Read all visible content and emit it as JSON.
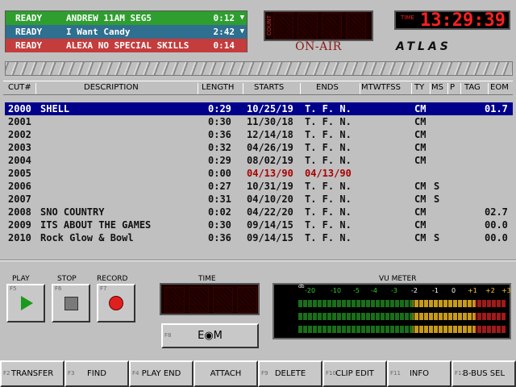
{
  "queue": [
    {
      "status": "READY",
      "title": "ANDREW 11AM SEG5",
      "time": "0:12",
      "color": "#2e9e2e",
      "arrow": "▼"
    },
    {
      "status": "READY",
      "title": "I Want Candy",
      "time": "2:42",
      "color": "#2f6f8f",
      "arrow": "▼"
    },
    {
      "status": "READY",
      "title": "ALEXA NO SPECIAL SKILLS",
      "time": "0:14",
      "color": "#c43c3c",
      "arrow": ""
    }
  ],
  "count_label": "COUNT",
  "onair": "ON-AIR",
  "clock": {
    "label": "TIME",
    "value": "13:29:39"
  },
  "logo": "ATLAS",
  "columns": [
    "CUT#",
    "DESCRIPTION",
    "LENGTH",
    "STARTS",
    "ENDS",
    "MTWTFSS",
    "TY",
    "MS",
    "P",
    "TAG",
    "EOM"
  ],
  "rows": [
    {
      "cut": "2000",
      "desc": "SHELL",
      "length": "0:29",
      "starts": "10/25/19",
      "ends": "T. F. N.",
      "ty": "CM",
      "ms": "",
      "eom": "01.7",
      "selected": true
    },
    {
      "cut": "2001",
      "desc": "",
      "length": "0:30",
      "starts": "11/30/18",
      "ends": "T. F. N.",
      "ty": "CM",
      "ms": "",
      "eom": ""
    },
    {
      "cut": "2002",
      "desc": "",
      "length": "0:36",
      "starts": "12/14/18",
      "ends": "T. F. N.",
      "ty": "CM",
      "ms": "",
      "eom": ""
    },
    {
      "cut": "2003",
      "desc": "",
      "length": "0:32",
      "starts": "04/26/19",
      "ends": "T. F. N.",
      "ty": "CM",
      "ms": "",
      "eom": ""
    },
    {
      "cut": "2004",
      "desc": "",
      "length": "0:29",
      "starts": "08/02/19",
      "ends": "T. F. N.",
      "ty": "CM",
      "ms": "",
      "eom": ""
    },
    {
      "cut": "2005",
      "desc": "",
      "length": "0:00",
      "starts": "04/13/90",
      "ends": "04/13/90",
      "ty": "",
      "ms": "",
      "eom": "",
      "expired": true
    },
    {
      "cut": "2006",
      "desc": "",
      "length": "0:27",
      "starts": "10/31/19",
      "ends": "T. F. N.",
      "ty": "CM",
      "ms": "S",
      "eom": ""
    },
    {
      "cut": "2007",
      "desc": "",
      "length": "0:31",
      "starts": "04/10/20",
      "ends": "T. F. N.",
      "ty": "CM",
      "ms": "S",
      "eom": ""
    },
    {
      "cut": "2008",
      "desc": "SNO COUNTRY",
      "length": "0:02",
      "starts": "04/22/20",
      "ends": "T. F. N.",
      "ty": "CM",
      "ms": "",
      "eom": "02.7"
    },
    {
      "cut": "2009",
      "desc": "ITS ABOUT THE GAMES",
      "length": "0:30",
      "starts": "09/14/15",
      "ends": "T. F. N.",
      "ty": "CM",
      "ms": "",
      "eom": "00.0"
    },
    {
      "cut": "2010",
      "desc": "Rock Glow & Bowl",
      "length": "0:36",
      "starts": "09/14/15",
      "ends": "T. F. N.",
      "ty": "CM",
      "ms": "S",
      "eom": "00.0"
    }
  ],
  "transport": {
    "play": "PLAY",
    "stop": "STOP",
    "record": "RECORD",
    "play_key": "F5",
    "stop_key": "F6",
    "record_key": "F7",
    "time_label": "TIME",
    "eom_label": "E◉M",
    "eom_key": "F8"
  },
  "vu": {
    "label": "VU METER",
    "db": "db",
    "ticks": [
      {
        "t": "-20",
        "c": "#3c3"
      },
      {
        "t": "-10",
        "c": "#3c3"
      },
      {
        "t": "-5",
        "c": "#3c3"
      },
      {
        "t": "-4",
        "c": "#3c3"
      },
      {
        "t": "-3",
        "c": "#3c3"
      },
      {
        "t": "-2",
        "c": "#fff"
      },
      {
        "t": "-1",
        "c": "#fff"
      },
      {
        "t": "0",
        "c": "#fff"
      },
      {
        "t": "+1",
        "c": "#fc3"
      },
      {
        "t": "+2",
        "c": "#fc3"
      },
      {
        "t": "+3",
        "c": "#fc3"
      }
    ],
    "left": "L>",
    "right": "R>"
  },
  "fkeys": [
    {
      "key": "F2",
      "label": "TRANSFER"
    },
    {
      "key": "F3",
      "label": "FIND"
    },
    {
      "key": "F4",
      "label": "PLAY END"
    },
    {
      "key": "",
      "label": "ATTACH"
    },
    {
      "key": "F9",
      "label": "DELETE"
    },
    {
      "key": "F10",
      "label": "CLIP EDIT"
    },
    {
      "key": "F11",
      "label": "INFO"
    },
    {
      "key": "F12",
      "label": "B-BUS SEL"
    }
  ]
}
